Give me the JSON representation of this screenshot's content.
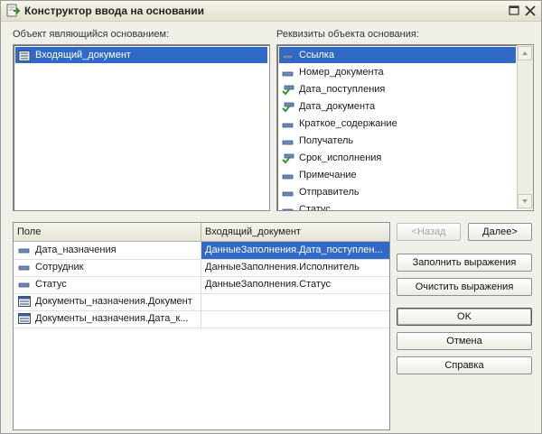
{
  "window": {
    "title": "Конструктор ввода на основании"
  },
  "left_panel": {
    "label": "Объект являющийся основанием:",
    "items": [
      {
        "label": "Входящий_документ",
        "icon": "document-icon",
        "selected": true
      }
    ]
  },
  "right_panel": {
    "label": "Реквизиты объекта основания:",
    "items": [
      {
        "label": "Ссылка",
        "icon": "attribute-icon",
        "selected": true
      },
      {
        "label": "Номер_документа",
        "icon": "attribute-icon"
      },
      {
        "label": "Дата_поступления",
        "icon": "attribute-used-icon"
      },
      {
        "label": "Дата_документа",
        "icon": "attribute-used-icon"
      },
      {
        "label": "Краткое_содержание",
        "icon": "attribute-icon"
      },
      {
        "label": "Получатель",
        "icon": "attribute-icon"
      },
      {
        "label": "Срок_исполнения",
        "icon": "attribute-used-icon"
      },
      {
        "label": "Примечание",
        "icon": "attribute-icon"
      },
      {
        "label": "Отправитель",
        "icon": "attribute-icon"
      },
      {
        "label": "Статус",
        "icon": "attribute-icon"
      }
    ]
  },
  "mapping_table": {
    "columns": [
      "Поле",
      "Входящий_документ"
    ],
    "rows": [
      {
        "field": "Дата_назначения",
        "icon": "attribute-icon",
        "expression": "ДанныеЗаполнения.Дата_поступлен...",
        "selected": true
      },
      {
        "field": "Сотрудник",
        "icon": "attribute-icon",
        "expression": "ДанныеЗаполнения.Исполнитель"
      },
      {
        "field": "Статус",
        "icon": "attribute-icon",
        "expression": "ДанныеЗаполнения.Статус"
      },
      {
        "field": "Документы_назначения.Документ",
        "icon": "table-icon",
        "expression": ""
      },
      {
        "field": "Документы_назначения.Дата_к...",
        "icon": "table-icon",
        "expression": ""
      }
    ]
  },
  "buttons": {
    "back": "<Назад",
    "next": "Далее>",
    "fill": "Заполнить выражения",
    "clear": "Очистить выражения",
    "ok": "OK",
    "cancel": "Отмена",
    "help": "Справка"
  },
  "colors": {
    "selection": "#3169c6",
    "window_bg": "#f0efe8"
  }
}
